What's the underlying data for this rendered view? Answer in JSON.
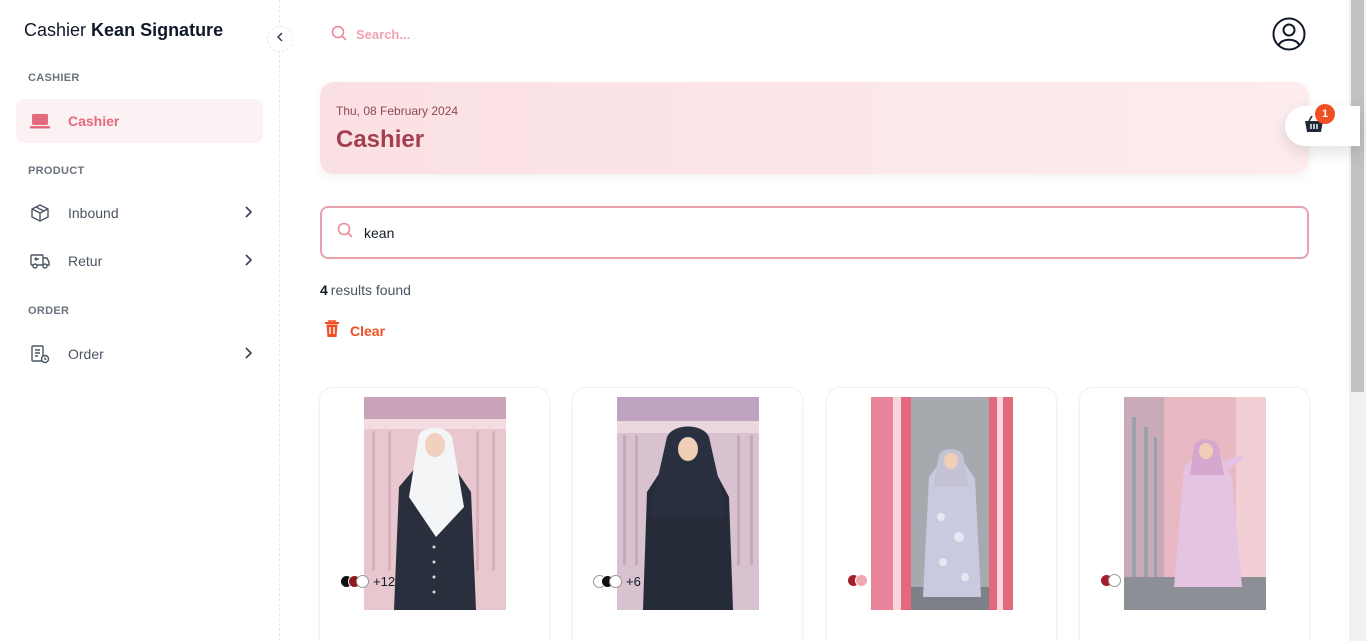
{
  "brand": {
    "prefix": "Cashier",
    "name": "Kean Signature"
  },
  "sidebar": {
    "sections": [
      {
        "label": "CASHIER"
      },
      {
        "label": "PRODUCT"
      },
      {
        "label": "ORDER"
      }
    ],
    "items": [
      {
        "label": "Cashier",
        "icon": "laptop-icon",
        "active": true
      },
      {
        "label": "Inbound",
        "icon": "box-icon"
      },
      {
        "label": "Retur",
        "icon": "truck-return-icon"
      },
      {
        "label": "Order",
        "icon": "order-list-icon"
      }
    ]
  },
  "topbar": {
    "search_placeholder": "Search..."
  },
  "header": {
    "date": "Thu, 08 February 2024",
    "title": "Cashier"
  },
  "cart": {
    "count": "1"
  },
  "search": {
    "value": "kean"
  },
  "results": {
    "count": "4",
    "text": "results found"
  },
  "clear": {
    "label": "Clear"
  },
  "products": [
    {
      "swatches": [
        "#111111",
        "#8b1c1c",
        "#ffffff"
      ],
      "more": "+12",
      "photo": "navy-dress-white-hijab"
    },
    {
      "swatches": [
        "#ffffff",
        "#111111",
        "#ffffff"
      ],
      "more": "+6",
      "photo": "navy-dress-navy-hijab"
    },
    {
      "swatches": [
        "#a31d2a",
        "#f2a7b3"
      ],
      "more": "",
      "photo": "floral-dress"
    },
    {
      "swatches": [
        "#a31d2a",
        "#ffffff"
      ],
      "more": "",
      "photo": "lilac-dress"
    }
  ],
  "colors": {
    "accent": "#e36a7d",
    "danger": "#f04e23",
    "header_bg": "#fbe0e3"
  }
}
